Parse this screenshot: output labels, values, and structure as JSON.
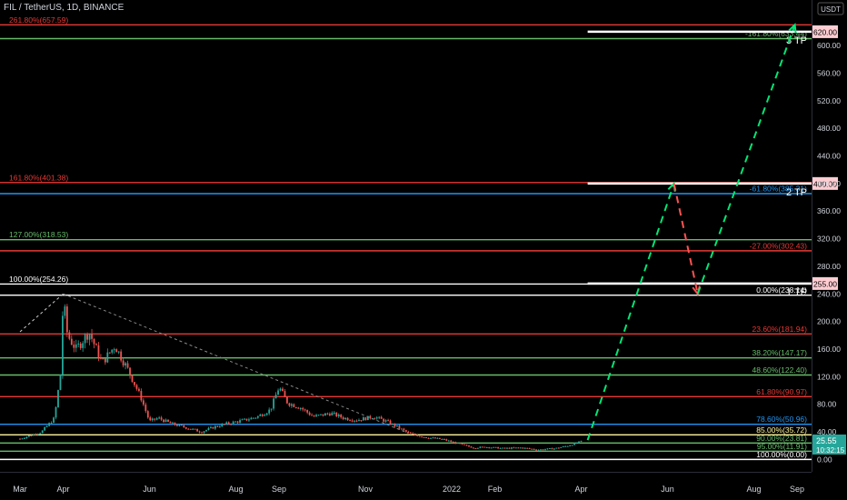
{
  "header": {
    "symbol": "FIL / TetherUS, 1D, BINANCE",
    "currency": "USDT"
  },
  "colors": {
    "background": "#000000",
    "up": "#26a69a",
    "down": "#ef5350",
    "fib_red": "#e53935",
    "fib_green": "#66bb6a",
    "fib_blue": "#2196f3",
    "fib_white": "#ffffff",
    "fib_yellow": "#fff59d",
    "trend": "#888888",
    "proj_up": "#00e676",
    "proj_down": "#ff5252",
    "price_tag": "#26a69a",
    "axis_text": "#d1d4dc"
  },
  "chart_data": {
    "type": "candlestick",
    "y_axis": {
      "range": [
        -14,
        666
      ],
      "ticks": [
        0,
        40,
        80,
        120,
        160,
        200,
        240,
        280,
        320,
        360,
        400,
        440,
        480,
        520,
        560,
        600
      ],
      "tick_labels": [
        "0.00",
        "40.00",
        "80.00",
        "120.00",
        "160.00",
        "200.00",
        "240.00",
        "280.00",
        "320.00",
        "360.00",
        "400.00",
        "440.00",
        "480.00",
        "520.00",
        "560.00",
        "600.00"
      ]
    },
    "x_axis": {
      "labels": [
        {
          "label": "Mar",
          "month": 0
        },
        {
          "label": "Apr",
          "month": 1
        },
        {
          "label": "Jun",
          "month": 3
        },
        {
          "label": "Aug",
          "month": 5
        },
        {
          "label": "Sep",
          "month": 6
        },
        {
          "label": "Nov",
          "month": 8
        },
        {
          "label": "2022",
          "month": 10
        },
        {
          "label": "Feb",
          "month": 11
        },
        {
          "label": "Apr",
          "month": 13
        },
        {
          "label": "Jun",
          "month": 15
        },
        {
          "label": "Aug",
          "month": 17
        },
        {
          "label": "Sep",
          "month": 18
        }
      ]
    },
    "price_path": [
      [
        0.0,
        30
      ],
      [
        0.5,
        40
      ],
      [
        0.8,
        60
      ],
      [
        0.95,
        130
      ],
      [
        1.0,
        235
      ],
      [
        1.1,
        180
      ],
      [
        1.3,
        160
      ],
      [
        1.6,
        185
      ],
      [
        1.9,
        140
      ],
      [
        2.2,
        165
      ],
      [
        2.5,
        130
      ],
      [
        2.8,
        90
      ],
      [
        3.0,
        55
      ],
      [
        3.2,
        60
      ],
      [
        3.5,
        52
      ],
      [
        3.8,
        47
      ],
      [
        4.2,
        40
      ],
      [
        4.5,
        47
      ],
      [
        4.8,
        52
      ],
      [
        5.2,
        57
      ],
      [
        5.5,
        62
      ],
      [
        5.8,
        72
      ],
      [
        6.0,
        105
      ],
      [
        6.2,
        82
      ],
      [
        6.5,
        75
      ],
      [
        6.8,
        62
      ],
      [
        7.2,
        67
      ],
      [
        7.5,
        60
      ],
      [
        7.8,
        57
      ],
      [
        8.2,
        62
      ],
      [
        8.5,
        55
      ],
      [
        8.8,
        45
      ],
      [
        9.0,
        38
      ],
      [
        9.4,
        32
      ],
      [
        9.8,
        29
      ],
      [
        10.2,
        22
      ],
      [
        10.5,
        17
      ],
      [
        10.8,
        18
      ],
      [
        11.2,
        16
      ],
      [
        11.6,
        17
      ],
      [
        12.0,
        14
      ],
      [
        12.4,
        16
      ],
      [
        12.7,
        20
      ],
      [
        13.0,
        26
      ]
    ],
    "fib_lines": [
      {
        "price": 630,
        "label": "261.80%(657.59)",
        "side": "left",
        "color": "fib_red"
      },
      {
        "price": 610,
        "label": "-161.80%(633.44)",
        "side": "right",
        "color": "fib_green"
      },
      {
        "price": 401.38,
        "label": "161.80%(401.38)",
        "side": "left",
        "color": "fib_red"
      },
      {
        "price": 385.31,
        "label": "-61.80%(385.31)",
        "side": "right",
        "color": "fib_blue"
      },
      {
        "price": 318.53,
        "label": "127.00%(318.53)",
        "side": "left",
        "color": "fib_green"
      },
      {
        "price": 302.43,
        "label": "-27.00%(302.43)",
        "side": "right",
        "color": "fib_red"
      },
      {
        "price": 254.26,
        "label": "100.00%(254.26)",
        "side": "left",
        "color": "fib_white"
      },
      {
        "price": 238.14,
        "label": "0.00%(238.14)",
        "side": "right",
        "color": "fib_white"
      },
      {
        "price": 181.94,
        "label": "23.60%(181.94)",
        "side": "right",
        "color": "fib_red"
      },
      {
        "price": 147.17,
        "label": "38.20%(147.17)",
        "side": "right",
        "color": "fib_green"
      },
      {
        "price": 122.4,
        "label": "48.60%(122.40)",
        "side": "right",
        "color": "fib_green"
      },
      {
        "price": 90.97,
        "label": "61.80%(90.97)",
        "side": "right",
        "color": "fib_red"
      },
      {
        "price": 50.96,
        "label": "78.60%(50.96)",
        "side": "right",
        "color": "fib_blue"
      },
      {
        "price": 35.72,
        "label": "85.00%(35.72)",
        "side": "right",
        "color": "fib_yellow"
      },
      {
        "price": 23.81,
        "label": "90.00%(23.81)",
        "side": "right",
        "color": "fib_green"
      },
      {
        "price": 11.91,
        "label": "95.00%(11.91)",
        "side": "right",
        "color": "fib_green"
      },
      {
        "price": 0.0,
        "label": "100.00%(0.00)",
        "side": "right",
        "color": "fib_white"
      }
    ],
    "targets": [
      {
        "name": "3 TP",
        "price": 620,
        "tag": "620.00"
      },
      {
        "name": "2 TP",
        "price": 400,
        "tag": "400.00"
      },
      {
        "name": "1 TP",
        "price": 255,
        "tag": "255.00"
      }
    ],
    "projection_path": [
      {
        "month": 13.15,
        "price": 28
      },
      {
        "month": 15.15,
        "price": 400
      },
      {
        "month": 15.7,
        "price": 240
      },
      {
        "month": 17.95,
        "price": 630
      }
    ],
    "trend_line": [
      {
        "month": 1.0,
        "price": 240
      },
      {
        "month": 9.0,
        "price": 38
      }
    ],
    "left_dash_line": [
      {
        "month": 0.0,
        "price": 185
      },
      {
        "month": 1.0,
        "price": 240
      }
    ],
    "last_price": {
      "value": 25.55,
      "label": "25.55",
      "countdown": "10:32:15"
    }
  }
}
